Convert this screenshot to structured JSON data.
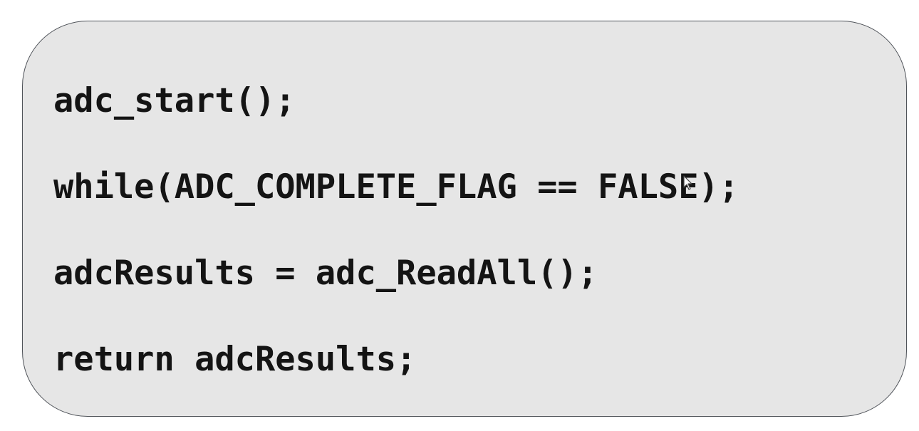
{
  "code_snippet": {
    "lines": [
      "adc_start();",
      "while(ADC_COMPLETE_FLAG == FALSE);",
      "adcResults = adc_ReadAll();",
      "return adcResults;"
    ]
  },
  "colors": {
    "panel_background": "#e6e6e6",
    "panel_border": "#4f5359",
    "text": "#141414"
  },
  "icons": {
    "cursor": "mouse-pointer-icon"
  }
}
